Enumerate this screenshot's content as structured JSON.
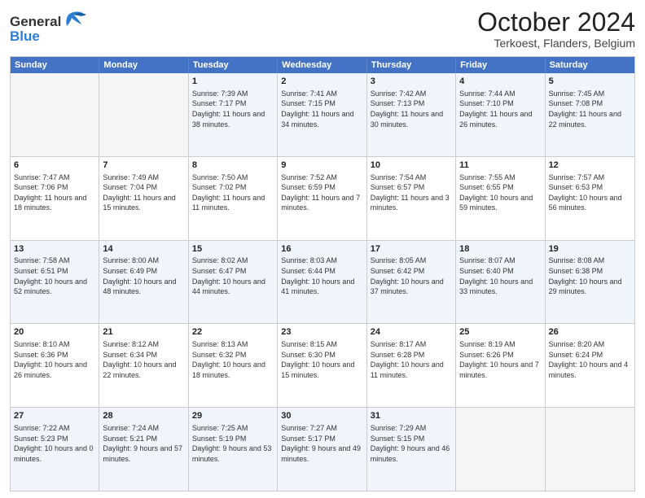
{
  "header": {
    "logo_line1": "General",
    "logo_line2": "Blue",
    "month": "October 2024",
    "location": "Terkoest, Flanders, Belgium"
  },
  "weekdays": [
    "Sunday",
    "Monday",
    "Tuesday",
    "Wednesday",
    "Thursday",
    "Friday",
    "Saturday"
  ],
  "rows": [
    [
      {
        "day": "",
        "sunrise": "",
        "sunset": "",
        "daylight": ""
      },
      {
        "day": "",
        "sunrise": "",
        "sunset": "",
        "daylight": ""
      },
      {
        "day": "1",
        "sunrise": "Sunrise: 7:39 AM",
        "sunset": "Sunset: 7:17 PM",
        "daylight": "Daylight: 11 hours and 38 minutes."
      },
      {
        "day": "2",
        "sunrise": "Sunrise: 7:41 AM",
        "sunset": "Sunset: 7:15 PM",
        "daylight": "Daylight: 11 hours and 34 minutes."
      },
      {
        "day": "3",
        "sunrise": "Sunrise: 7:42 AM",
        "sunset": "Sunset: 7:13 PM",
        "daylight": "Daylight: 11 hours and 30 minutes."
      },
      {
        "day": "4",
        "sunrise": "Sunrise: 7:44 AM",
        "sunset": "Sunset: 7:10 PM",
        "daylight": "Daylight: 11 hours and 26 minutes."
      },
      {
        "day": "5",
        "sunrise": "Sunrise: 7:45 AM",
        "sunset": "Sunset: 7:08 PM",
        "daylight": "Daylight: 11 hours and 22 minutes."
      }
    ],
    [
      {
        "day": "6",
        "sunrise": "Sunrise: 7:47 AM",
        "sunset": "Sunset: 7:06 PM",
        "daylight": "Daylight: 11 hours and 18 minutes."
      },
      {
        "day": "7",
        "sunrise": "Sunrise: 7:49 AM",
        "sunset": "Sunset: 7:04 PM",
        "daylight": "Daylight: 11 hours and 15 minutes."
      },
      {
        "day": "8",
        "sunrise": "Sunrise: 7:50 AM",
        "sunset": "Sunset: 7:02 PM",
        "daylight": "Daylight: 11 hours and 11 minutes."
      },
      {
        "day": "9",
        "sunrise": "Sunrise: 7:52 AM",
        "sunset": "Sunset: 6:59 PM",
        "daylight": "Daylight: 11 hours and 7 minutes."
      },
      {
        "day": "10",
        "sunrise": "Sunrise: 7:54 AM",
        "sunset": "Sunset: 6:57 PM",
        "daylight": "Daylight: 11 hours and 3 minutes."
      },
      {
        "day": "11",
        "sunrise": "Sunrise: 7:55 AM",
        "sunset": "Sunset: 6:55 PM",
        "daylight": "Daylight: 10 hours and 59 minutes."
      },
      {
        "day": "12",
        "sunrise": "Sunrise: 7:57 AM",
        "sunset": "Sunset: 6:53 PM",
        "daylight": "Daylight: 10 hours and 56 minutes."
      }
    ],
    [
      {
        "day": "13",
        "sunrise": "Sunrise: 7:58 AM",
        "sunset": "Sunset: 6:51 PM",
        "daylight": "Daylight: 10 hours and 52 minutes."
      },
      {
        "day": "14",
        "sunrise": "Sunrise: 8:00 AM",
        "sunset": "Sunset: 6:49 PM",
        "daylight": "Daylight: 10 hours and 48 minutes."
      },
      {
        "day": "15",
        "sunrise": "Sunrise: 8:02 AM",
        "sunset": "Sunset: 6:47 PM",
        "daylight": "Daylight: 10 hours and 44 minutes."
      },
      {
        "day": "16",
        "sunrise": "Sunrise: 8:03 AM",
        "sunset": "Sunset: 6:44 PM",
        "daylight": "Daylight: 10 hours and 41 minutes."
      },
      {
        "day": "17",
        "sunrise": "Sunrise: 8:05 AM",
        "sunset": "Sunset: 6:42 PM",
        "daylight": "Daylight: 10 hours and 37 minutes."
      },
      {
        "day": "18",
        "sunrise": "Sunrise: 8:07 AM",
        "sunset": "Sunset: 6:40 PM",
        "daylight": "Daylight: 10 hours and 33 minutes."
      },
      {
        "day": "19",
        "sunrise": "Sunrise: 8:08 AM",
        "sunset": "Sunset: 6:38 PM",
        "daylight": "Daylight: 10 hours and 29 minutes."
      }
    ],
    [
      {
        "day": "20",
        "sunrise": "Sunrise: 8:10 AM",
        "sunset": "Sunset: 6:36 PM",
        "daylight": "Daylight: 10 hours and 26 minutes."
      },
      {
        "day": "21",
        "sunrise": "Sunrise: 8:12 AM",
        "sunset": "Sunset: 6:34 PM",
        "daylight": "Daylight: 10 hours and 22 minutes."
      },
      {
        "day": "22",
        "sunrise": "Sunrise: 8:13 AM",
        "sunset": "Sunset: 6:32 PM",
        "daylight": "Daylight: 10 hours and 18 minutes."
      },
      {
        "day": "23",
        "sunrise": "Sunrise: 8:15 AM",
        "sunset": "Sunset: 6:30 PM",
        "daylight": "Daylight: 10 hours and 15 minutes."
      },
      {
        "day": "24",
        "sunrise": "Sunrise: 8:17 AM",
        "sunset": "Sunset: 6:28 PM",
        "daylight": "Daylight: 10 hours and 11 minutes."
      },
      {
        "day": "25",
        "sunrise": "Sunrise: 8:19 AM",
        "sunset": "Sunset: 6:26 PM",
        "daylight": "Daylight: 10 hours and 7 minutes."
      },
      {
        "day": "26",
        "sunrise": "Sunrise: 8:20 AM",
        "sunset": "Sunset: 6:24 PM",
        "daylight": "Daylight: 10 hours and 4 minutes."
      }
    ],
    [
      {
        "day": "27",
        "sunrise": "Sunrise: 7:22 AM",
        "sunset": "Sunset: 5:23 PM",
        "daylight": "Daylight: 10 hours and 0 minutes."
      },
      {
        "day": "28",
        "sunrise": "Sunrise: 7:24 AM",
        "sunset": "Sunset: 5:21 PM",
        "daylight": "Daylight: 9 hours and 57 minutes."
      },
      {
        "day": "29",
        "sunrise": "Sunrise: 7:25 AM",
        "sunset": "Sunset: 5:19 PM",
        "daylight": "Daylight: 9 hours and 53 minutes."
      },
      {
        "day": "30",
        "sunrise": "Sunrise: 7:27 AM",
        "sunset": "Sunset: 5:17 PM",
        "daylight": "Daylight: 9 hours and 49 minutes."
      },
      {
        "day": "31",
        "sunrise": "Sunrise: 7:29 AM",
        "sunset": "Sunset: 5:15 PM",
        "daylight": "Daylight: 9 hours and 46 minutes."
      },
      {
        "day": "",
        "sunrise": "",
        "sunset": "",
        "daylight": ""
      },
      {
        "day": "",
        "sunrise": "",
        "sunset": "",
        "daylight": ""
      }
    ]
  ],
  "alt_rows": [
    0,
    2,
    4
  ]
}
